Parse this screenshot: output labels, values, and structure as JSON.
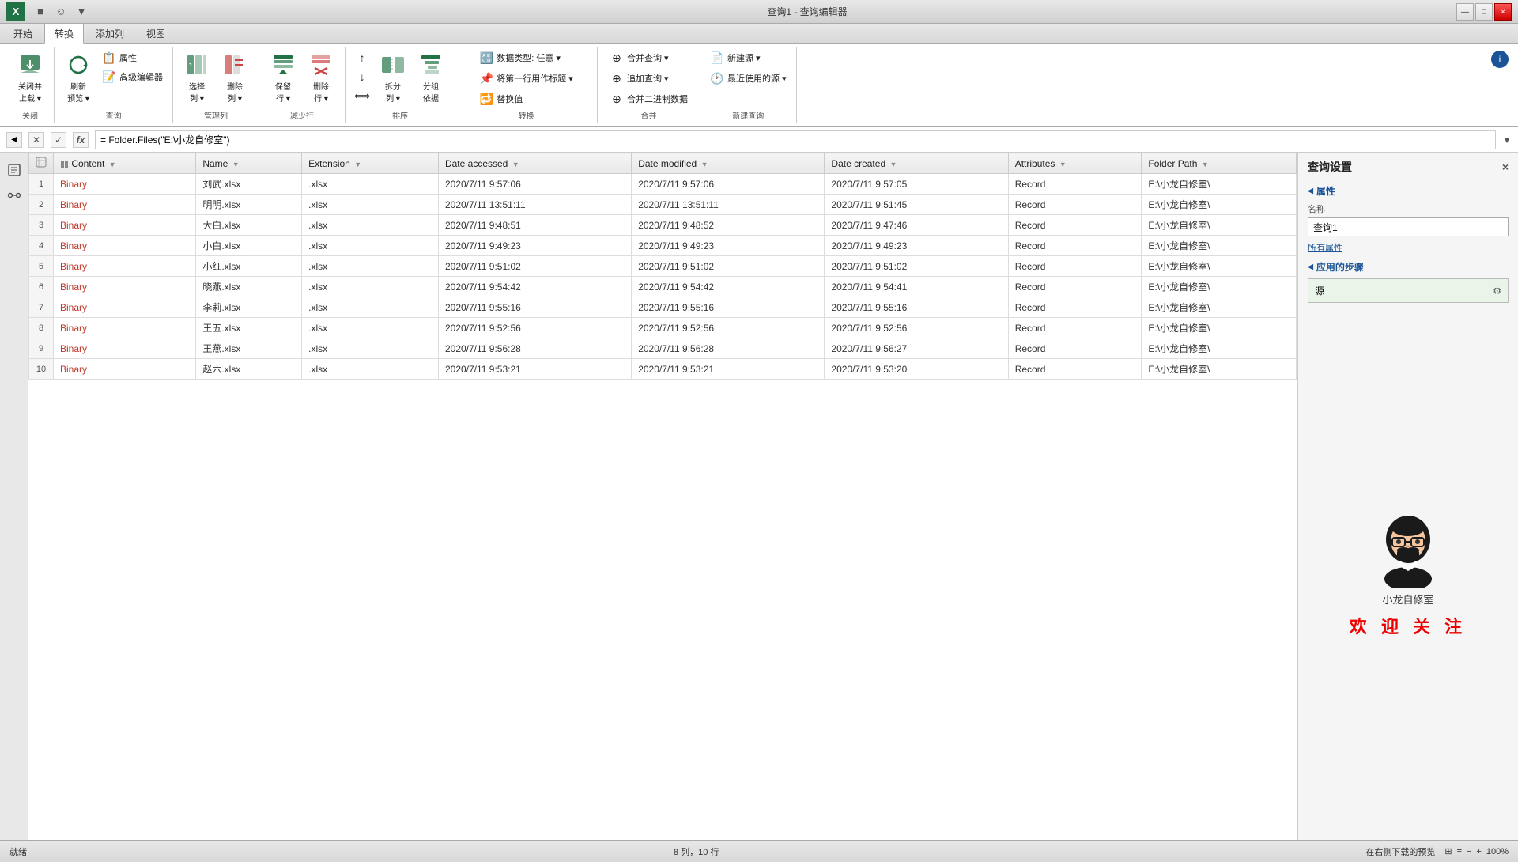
{
  "titleBar": {
    "appIcon": "X",
    "title": "查询1 - 查询编辑器",
    "buttons": [
      "—",
      "□",
      "×"
    ]
  },
  "quickAccess": {
    "buttons": [
      "■",
      "☺",
      "▼"
    ]
  },
  "ribbonTabs": [
    "开始",
    "转换",
    "添加列",
    "视图"
  ],
  "ribbonGroups": {
    "close": {
      "label": "关闭",
      "buttons": [
        {
          "label": "关闭并\n上载",
          "icon": "📤"
        }
      ]
    },
    "query": {
      "label": "查询",
      "buttons": [
        {
          "label": "刷新\n预览",
          "icon": "🔄"
        },
        {
          "label": "属性",
          "icon": "📋"
        },
        {
          "label": "高级编辑器",
          "icon": "📝"
        }
      ]
    },
    "manage": {
      "label": "管理列",
      "buttons": [
        {
          "label": "选择\n列",
          "icon": "▦"
        },
        {
          "label": "删除\n列",
          "icon": "✖"
        }
      ]
    },
    "reduce": {
      "label": "减少行",
      "buttons": [
        {
          "label": "保留\n行",
          "icon": "↑"
        },
        {
          "label": "删除\n行",
          "icon": "✗"
        }
      ]
    },
    "sort": {
      "label": "排序",
      "buttons": [
        {
          "label": "拆分\n列",
          "icon": "⟺"
        },
        {
          "label": "分组\n依据",
          "icon": "≡"
        }
      ]
    },
    "transform": {
      "label": "转换",
      "buttons": [
        {
          "label": "数据类型: 任意",
          "icon": "🔠"
        },
        {
          "label": "将第一行用作标题",
          "icon": "📌"
        },
        {
          "label": "替换值",
          "icon": "🔁"
        }
      ]
    },
    "combine": {
      "label": "合并",
      "buttons": [
        {
          "label": "合并查询",
          "icon": "⊕"
        },
        {
          "label": "追加查询",
          "icon": "⊕"
        },
        {
          "label": "合并二进制数据",
          "icon": "⊕"
        }
      ]
    },
    "newQuery": {
      "label": "新建查询",
      "buttons": [
        {
          "label": "新建源",
          "icon": "📄"
        },
        {
          "label": "最近使用的源",
          "icon": "🕐"
        }
      ]
    }
  },
  "formulaBar": {
    "cancelBtn": "✕",
    "confirmBtn": "✓",
    "fxLabel": "fx",
    "formula": "= Folder.Files(\"E:\\小龙自修室\")",
    "expandBtn": "▼"
  },
  "table": {
    "columns": [
      {
        "name": "Content",
        "icon": "⊞",
        "sortIcon": "↕"
      },
      {
        "name": "Name",
        "icon": "",
        "sortIcon": "↕"
      },
      {
        "name": "Extension",
        "icon": "",
        "sortIcon": "↕"
      },
      {
        "name": "Date accessed",
        "icon": "",
        "sortIcon": "↕"
      },
      {
        "name": "Date modified",
        "icon": "",
        "sortIcon": "↕"
      },
      {
        "name": "Date created",
        "icon": "",
        "sortIcon": "↕"
      },
      {
        "name": "Attributes",
        "icon": "",
        "sortIcon": "↕"
      },
      {
        "name": "Folder Path",
        "icon": "",
        "sortIcon": "↕"
      }
    ],
    "rows": [
      {
        "num": 1,
        "content": "Binary",
        "name": "刘武.xlsx",
        "ext": ".xlsx",
        "accessed": "2020/7/11 9:57:06",
        "modified": "2020/7/11 9:57:06",
        "created": "2020/7/11 9:57:05",
        "attrs": "Record",
        "path": "E:\\小龙自修室\\"
      },
      {
        "num": 2,
        "content": "Binary",
        "name": "明明.xlsx",
        "ext": ".xlsx",
        "accessed": "2020/7/11 13:51:11",
        "modified": "2020/7/11 13:51:11",
        "created": "2020/7/11 9:51:45",
        "attrs": "Record",
        "path": "E:\\小龙自修室\\"
      },
      {
        "num": 3,
        "content": "Binary",
        "name": "大白.xlsx",
        "ext": ".xlsx",
        "accessed": "2020/7/11 9:48:51",
        "modified": "2020/7/11 9:48:52",
        "created": "2020/7/11 9:47:46",
        "attrs": "Record",
        "path": "E:\\小龙自修室\\"
      },
      {
        "num": 4,
        "content": "Binary",
        "name": "小白.xlsx",
        "ext": ".xlsx",
        "accessed": "2020/7/11 9:49:23",
        "modified": "2020/7/11 9:49:23",
        "created": "2020/7/11 9:49:23",
        "attrs": "Record",
        "path": "E:\\小龙自修室\\"
      },
      {
        "num": 5,
        "content": "Binary",
        "name": "小红.xlsx",
        "ext": ".xlsx",
        "accessed": "2020/7/11 9:51:02",
        "modified": "2020/7/11 9:51:02",
        "created": "2020/7/11 9:51:02",
        "attrs": "Record",
        "path": "E:\\小龙自修室\\"
      },
      {
        "num": 6,
        "content": "Binary",
        "name": "晓燕.xlsx",
        "ext": ".xlsx",
        "accessed": "2020/7/11 9:54:42",
        "modified": "2020/7/11 9:54:42",
        "created": "2020/7/11 9:54:41",
        "attrs": "Record",
        "path": "E:\\小龙自修室\\"
      },
      {
        "num": 7,
        "content": "Binary",
        "name": "李莉.xlsx",
        "ext": ".xlsx",
        "accessed": "2020/7/11 9:55:16",
        "modified": "2020/7/11 9:55:16",
        "created": "2020/7/11 9:55:16",
        "attrs": "Record",
        "path": "E:\\小龙自修室\\"
      },
      {
        "num": 8,
        "content": "Binary",
        "name": "王五.xlsx",
        "ext": ".xlsx",
        "accessed": "2020/7/11 9:52:56",
        "modified": "2020/7/11 9:52:56",
        "created": "2020/7/11 9:52:56",
        "attrs": "Record",
        "path": "E:\\小龙自修室\\"
      },
      {
        "num": 9,
        "content": "Binary",
        "name": "王燕.xlsx",
        "ext": ".xlsx",
        "accessed": "2020/7/11 9:56:28",
        "modified": "2020/7/11 9:56:28",
        "created": "2020/7/11 9:56:27",
        "attrs": "Record",
        "path": "E:\\小龙自修室\\"
      },
      {
        "num": 10,
        "content": "Binary",
        "name": "赵六.xlsx",
        "ext": ".xlsx",
        "accessed": "2020/7/11 9:53:21",
        "modified": "2020/7/11 9:53:21",
        "created": "2020/7/11 9:53:20",
        "attrs": "Record",
        "path": "E:\\小龙自修室\\"
      }
    ]
  },
  "rightPanel": {
    "title": "查询设置",
    "closeBtn": "×",
    "sections": {
      "properties": {
        "title": "属性",
        "nameLabel": "名称",
        "nameValue": "查询1",
        "allPropsLink": "所有属性"
      },
      "appliedSteps": {
        "title": "应用的步骤",
        "steps": [
          {
            "name": "源"
          }
        ]
      }
    }
  },
  "statusBar": {
    "left": "就绪",
    "middle": "8 列，10 行",
    "right": "在右侧下载的预览",
    "zoom": "100%",
    "icons": [
      "⊞",
      "≡",
      "—",
      "+"
    ]
  }
}
